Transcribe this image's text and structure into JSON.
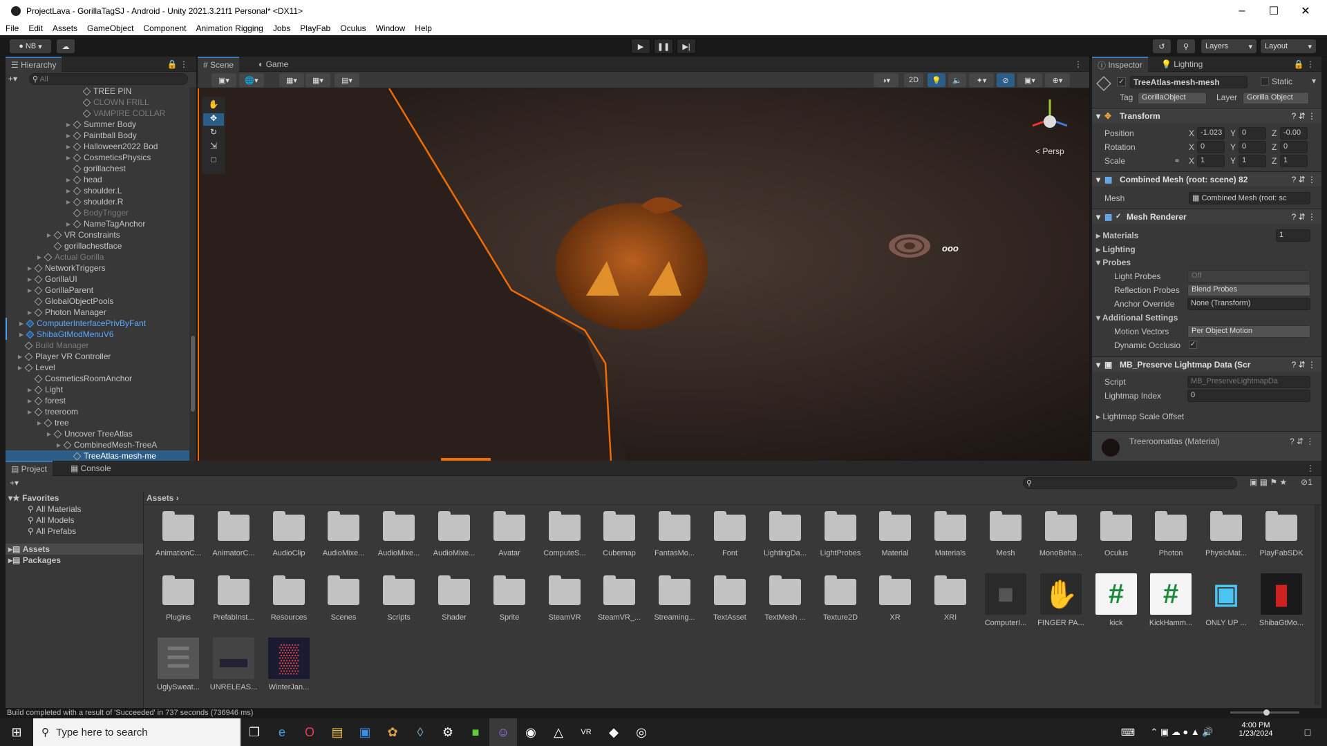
{
  "window": {
    "title": "ProjectLava - GorillaTagSJ - Android - Unity 2021.3.21f1 Personal* <DX11>"
  },
  "menu": [
    "File",
    "Edit",
    "Assets",
    "GameObject",
    "Component",
    "Animation Rigging",
    "Jobs",
    "PlayFab",
    "Oculus",
    "Window",
    "Help"
  ],
  "toolbar": {
    "account": "NB",
    "layers": "Layers",
    "layout": "Layout"
  },
  "hierarchy": {
    "tab": "Hierarchy",
    "search_placeholder": "All",
    "items": [
      {
        "label": "TREE PIN",
        "indent": 9,
        "arrow": false,
        "dim": false,
        "blue": false
      },
      {
        "label": "CLOWN FRILL",
        "indent": 9,
        "arrow": false,
        "dim": true,
        "blue": false
      },
      {
        "label": "VAMPIRE COLLAR",
        "indent": 9,
        "arrow": false,
        "dim": true,
        "blue": false
      },
      {
        "label": "Summer Body",
        "indent": 8,
        "arrow": true,
        "dim": false,
        "blue": false
      },
      {
        "label": "Paintball Body",
        "indent": 8,
        "arrow": true,
        "dim": false,
        "blue": false
      },
      {
        "label": "Halloween2022 Bod",
        "indent": 8,
        "arrow": true,
        "dim": false,
        "blue": false
      },
      {
        "label": "CosmeticsPhysics",
        "indent": 8,
        "arrow": true,
        "dim": false,
        "blue": false
      },
      {
        "label": "gorillachest",
        "indent": 8,
        "arrow": false,
        "dim": false,
        "blue": false
      },
      {
        "label": "head",
        "indent": 8,
        "arrow": true,
        "dim": false,
        "blue": false
      },
      {
        "label": "shoulder.L",
        "indent": 8,
        "arrow": true,
        "dim": false,
        "blue": false
      },
      {
        "label": "shoulder.R",
        "indent": 8,
        "arrow": true,
        "dim": false,
        "blue": false
      },
      {
        "label": "BodyTrigger",
        "indent": 8,
        "arrow": false,
        "dim": true,
        "blue": false
      },
      {
        "label": "NameTagAnchor",
        "indent": 8,
        "arrow": true,
        "dim": false,
        "blue": false
      },
      {
        "label": "VR Constraints",
        "indent": 6,
        "arrow": true,
        "dim": false,
        "blue": false
      },
      {
        "label": "gorillachestface",
        "indent": 6,
        "arrow": false,
        "dim": false,
        "blue": false
      },
      {
        "label": "Actual Gorilla",
        "indent": 5,
        "arrow": true,
        "dim": true,
        "blue": false
      },
      {
        "label": "NetworkTriggers",
        "indent": 4,
        "arrow": true,
        "dim": false,
        "blue": false
      },
      {
        "label": "GorillaUI",
        "indent": 4,
        "arrow": true,
        "dim": false,
        "blue": false
      },
      {
        "label": "GorillaParent",
        "indent": 4,
        "arrow": true,
        "dim": false,
        "blue": false
      },
      {
        "label": "GlobalObjectPools",
        "indent": 4,
        "arrow": false,
        "dim": false,
        "blue": false
      },
      {
        "label": "Photon Manager",
        "indent": 4,
        "arrow": true,
        "dim": false,
        "blue": false
      },
      {
        "label": "ComputerInterfacePrivByFant",
        "indent": 3,
        "arrow": true,
        "dim": false,
        "blue": true
      },
      {
        "label": "ShibaGtModMenuV6",
        "indent": 3,
        "arrow": true,
        "dim": false,
        "blue": true
      },
      {
        "label": "Build Manager",
        "indent": 3,
        "arrow": false,
        "dim": true,
        "blue": false
      },
      {
        "label": "Player VR Controller",
        "indent": 3,
        "arrow": true,
        "dim": false,
        "blue": false
      },
      {
        "label": "Level",
        "indent": 3,
        "arrow": true,
        "dim": false,
        "blue": false
      },
      {
        "label": "CosmeticsRoomAnchor",
        "indent": 4,
        "arrow": false,
        "dim": false,
        "blue": false
      },
      {
        "label": "Light",
        "indent": 4,
        "arrow": true,
        "dim": false,
        "blue": false
      },
      {
        "label": "forest",
        "indent": 4,
        "arrow": true,
        "dim": false,
        "blue": false
      },
      {
        "label": "treeroom",
        "indent": 4,
        "arrow": true,
        "dim": false,
        "blue": false
      },
      {
        "label": "tree",
        "indent": 5,
        "arrow": true,
        "dim": false,
        "blue": false
      },
      {
        "label": "Uncover TreeAtlas",
        "indent": 6,
        "arrow": true,
        "dim": false,
        "blue": false
      },
      {
        "label": "CombinedMesh-TreeA",
        "indent": 7,
        "arrow": true,
        "dim": false,
        "blue": false
      },
      {
        "label": "TreeAtlas-mesh-me",
        "indent": 8,
        "arrow": false,
        "dim": false,
        "blue": false
      }
    ]
  },
  "scene": {
    "tabs": [
      "Scene",
      "Game"
    ],
    "mode2d": "2D",
    "persp": "< Persp"
  },
  "inspector": {
    "tabs": [
      "Inspector",
      "Lighting"
    ],
    "object_name": "TreeAtlas-mesh-mesh",
    "static": "Static",
    "tag_label": "Tag",
    "tag": "GorillaObject",
    "layer_label": "Layer",
    "layer": "Gorilla Object",
    "transform": {
      "title": "Transform",
      "position": "Position",
      "rotation": "Rotation",
      "scale": "Scale",
      "px": "-1.023",
      "py": "0",
      "pz": "-0.00",
      "rx": "0",
      "ry": "0",
      "rz": "0",
      "sx": "1",
      "sy": "1",
      "sz": "1"
    },
    "combined": {
      "title": "Combined Mesh (root: scene) 82",
      "mesh_label": "Mesh",
      "mesh": "Combined Mesh (root: sc"
    },
    "renderer": {
      "title": "Mesh Renderer",
      "materials": "Materials",
      "materials_count": "1",
      "lighting": "Lighting",
      "probes": "Probes",
      "light_probes": "Light Probes",
      "light_probes_val": "Off",
      "reflection": "Reflection Probes",
      "reflection_val": "Blend Probes",
      "anchor": "Anchor Override",
      "anchor_val": "None (Transform)",
      "additional": "Additional Settings",
      "motion": "Motion Vectors",
      "motion_val": "Per Object Motion",
      "dynamic": "Dynamic Occlusio"
    },
    "lightmap": {
      "title": "MB_Preserve Lightmap Data (Scr",
      "script_label": "Script",
      "script": "MB_PreserveLightmapDa",
      "index_label": "Lightmap Index",
      "index": "0",
      "offset": "Lightmap Scale Offset"
    },
    "material": "Treeroomatlas (Material)"
  },
  "project": {
    "tabs": [
      "Project",
      "Console"
    ],
    "favorites": "Favorites",
    "fav_items": [
      "All Materials",
      "All Models",
      "All Prefabs"
    ],
    "assets": "Assets",
    "packages": "Packages",
    "breadcrumb": "Assets",
    "hidden_count": "1",
    "items": [
      {
        "name": "AnimationC...",
        "type": "folder"
      },
      {
        "name": "AnimatorC...",
        "type": "folder"
      },
      {
        "name": "AudioClip",
        "type": "folder"
      },
      {
        "name": "AudioMixe...",
        "type": "folder"
      },
      {
        "name": "AudioMixe...",
        "type": "folder"
      },
      {
        "name": "AudioMixe...",
        "type": "folder"
      },
      {
        "name": "Avatar",
        "type": "folder"
      },
      {
        "name": "ComputeS...",
        "type": "folder"
      },
      {
        "name": "Cubemap",
        "type": "folder"
      },
      {
        "name": "FantasMo...",
        "type": "folder"
      },
      {
        "name": "Font",
        "type": "folder"
      },
      {
        "name": "LightingDa...",
        "type": "folder"
      },
      {
        "name": "LightProbes",
        "type": "folder"
      },
      {
        "name": "Material",
        "type": "folder"
      },
      {
        "name": "Materials",
        "type": "folder"
      },
      {
        "name": "Mesh",
        "type": "folder"
      },
      {
        "name": "MonoBeha...",
        "type": "folder"
      },
      {
        "name": "Oculus",
        "type": "folder"
      },
      {
        "name": "Photon",
        "type": "folder"
      },
      {
        "name": "PhysicMat...",
        "type": "folder"
      },
      {
        "name": "PlayFabSDK",
        "type": "folder"
      },
      {
        "name": "Plugins",
        "type": "folder"
      },
      {
        "name": "PrefabInst...",
        "type": "folder"
      },
      {
        "name": "Resources",
        "type": "folder"
      },
      {
        "name": "Scenes",
        "type": "folder"
      },
      {
        "name": "Scripts",
        "type": "folder"
      },
      {
        "name": "Shader",
        "type": "folder"
      },
      {
        "name": "Sprite",
        "type": "folder"
      },
      {
        "name": "SteamVR",
        "type": "folder"
      },
      {
        "name": "SteamVR_...",
        "type": "folder"
      },
      {
        "name": "Streaming...",
        "type": "folder"
      },
      {
        "name": "TextAsset",
        "type": "folder"
      },
      {
        "name": "TextMesh ...",
        "type": "folder"
      },
      {
        "name": "Texture2D",
        "type": "folder"
      },
      {
        "name": "XR",
        "type": "folder"
      },
      {
        "name": "XRI",
        "type": "folder"
      },
      {
        "name": "ComputerI...",
        "type": "dark"
      },
      {
        "name": "FINGER PA...",
        "type": "finger"
      },
      {
        "name": "kick",
        "type": "script"
      },
      {
        "name": "KickHamm...",
        "type": "script"
      },
      {
        "name": "ONLY UP ...",
        "type": "cube"
      },
      {
        "name": "ShibaGtMo...",
        "type": "shiba"
      },
      {
        "name": "UglySweat...",
        "type": "sweater"
      },
      {
        "name": "UNRELEAS...",
        "type": "sweater2"
      },
      {
        "name": "WinterJan...",
        "type": "winter"
      }
    ]
  },
  "status": "Build completed with a result of 'Succeeded' in 737 seconds (736946 ms)",
  "taskbar": {
    "search_placeholder": "Type here to search",
    "time": "4:00 PM",
    "date": "1/23/2024"
  },
  "colors": {
    "accent": "#3a79bb",
    "selection": "#2c5d87",
    "orange": "#f26b00"
  }
}
